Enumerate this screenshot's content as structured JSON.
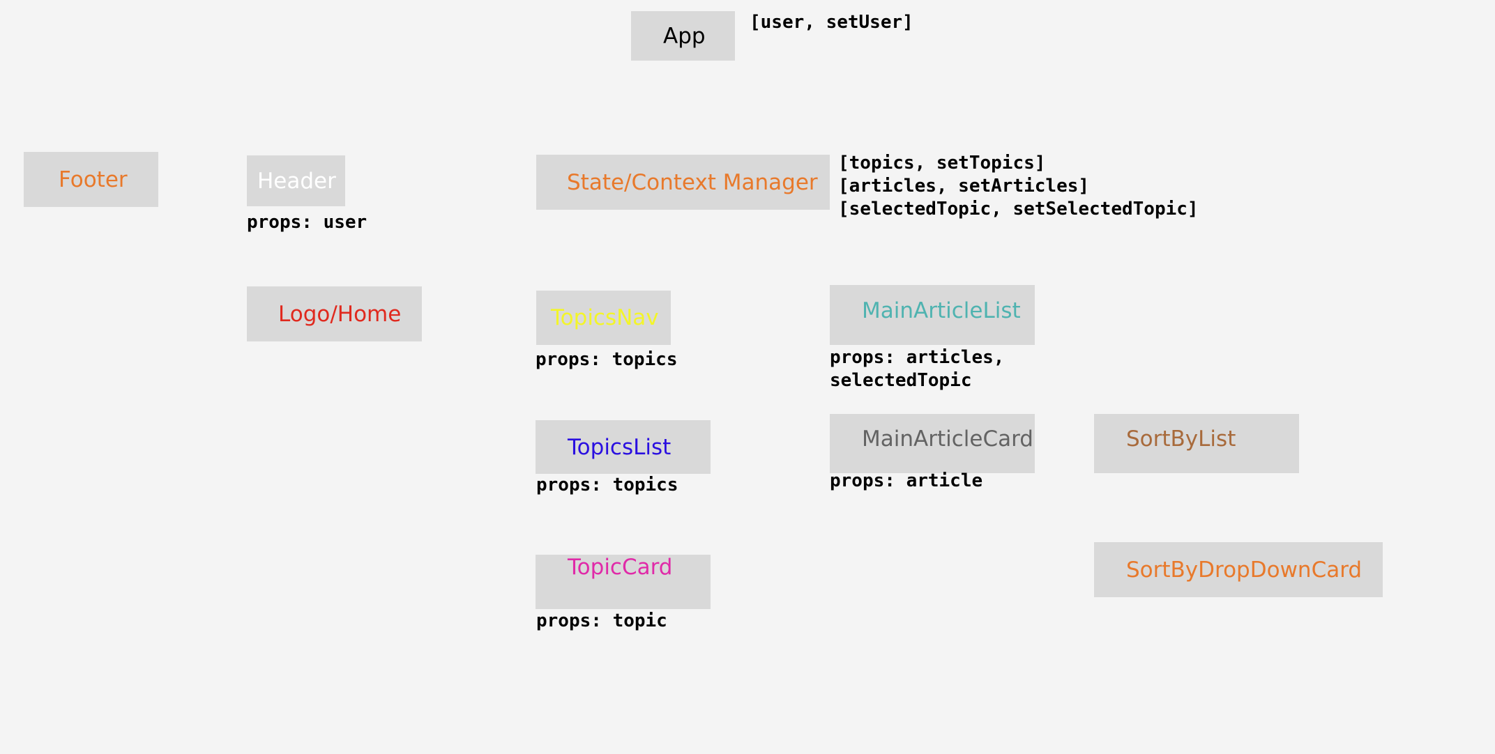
{
  "components": {
    "app": {
      "label": "App",
      "color": "#000000"
    },
    "footer": {
      "label": "Footer",
      "color": "#e8792b"
    },
    "header": {
      "label": "Header",
      "color": "#ffffff"
    },
    "logo_home": {
      "label": "Logo/Home",
      "color": "#e0291e"
    },
    "state_context_manager": {
      "label": "State/Context Manager",
      "color": "#e8792b"
    },
    "topics_nav": {
      "label": "TopicsNav",
      "color": "#f3f52a"
    },
    "main_article_list": {
      "label": "MainArticleList",
      "color": "#4fb3b0"
    },
    "topics_list": {
      "label": "TopicsList",
      "color": "#2a0fe0"
    },
    "main_article_card": {
      "label": "MainArticleCard",
      "color": "#636363"
    },
    "sort_by_list": {
      "label": "SortByList",
      "color": "#a86a3b"
    },
    "topic_card": {
      "label": "TopicCard",
      "color": "#e02aa8"
    },
    "sort_by_drop_down_card": {
      "label": "SortByDropDownCard",
      "color": "#e8792b"
    }
  },
  "notes": {
    "app_state": "[user, setUser]",
    "manager_state": [
      "[topics, setTopics]",
      "[articles, setArticles]",
      "[selectedTopic, setSelectedTopic]"
    ],
    "header_props": "props: user",
    "topics_nav_props": "props: topics",
    "main_article_list_props": [
      "props: articles,",
      "selectedTopic"
    ],
    "topics_list_props": "props: topics",
    "main_article_card_props": "props: article",
    "topic_card_props": "props: topic"
  }
}
